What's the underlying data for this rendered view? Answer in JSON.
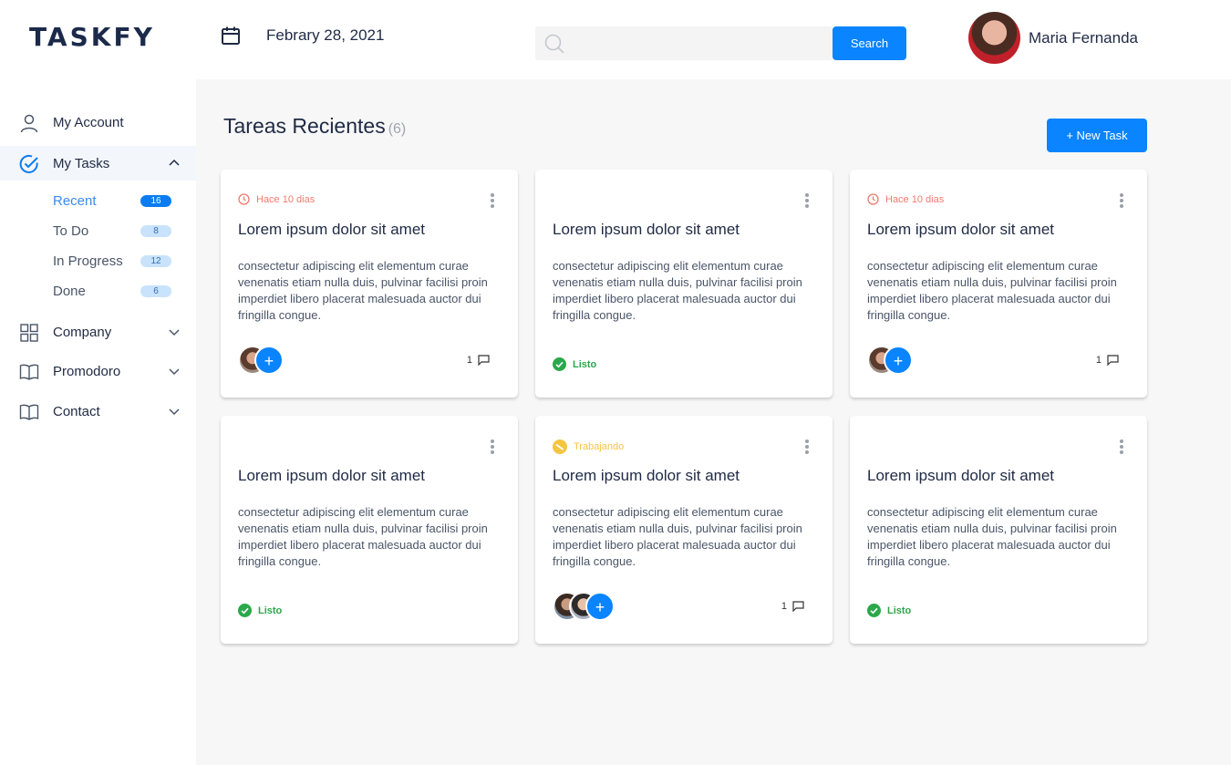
{
  "app": {
    "logo": "TASKFY"
  },
  "header": {
    "date": "Febrary 28, 2021",
    "search_placeholder": "",
    "search_button": "Search",
    "user_name": "Maria Fernanda"
  },
  "sidebar": {
    "items": [
      {
        "label": "My Account",
        "icon": "user-icon"
      },
      {
        "label": "My Tasks",
        "icon": "check-circle-icon"
      },
      {
        "label": "Company",
        "icon": "grid-icon"
      },
      {
        "label": "Promodoro",
        "icon": "book-icon"
      },
      {
        "label": "Contact",
        "icon": "book-icon"
      }
    ],
    "subitems": [
      {
        "label": "Recent",
        "count": "16"
      },
      {
        "label": "To Do",
        "count": "8"
      },
      {
        "label": "In Progress",
        "count": "12"
      },
      {
        "label": "Done",
        "count": "6"
      }
    ]
  },
  "main": {
    "title": "Tareas Recientes",
    "count": "(6)",
    "new_task_button": "+ New Task",
    "cards": [
      {
        "status": "Hace 10 dias",
        "title": "Lorem ipsum dolor sit amet",
        "description": "consectetur adipiscing elit elementum curae venenatis etiam nulla duis, pulvinar facilisi proin imperdiet libero placerat malesuada auctor dui fringilla congue.",
        "comments": "1"
      },
      {
        "title": "Lorem ipsum dolor sit amet",
        "description": "consectetur adipiscing elit elementum curae venenatis etiam nulla duis, pulvinar facilisi proin imperdiet libero placerat malesuada auctor dui fringilla congue.",
        "done_label": "Listo"
      },
      {
        "status": "Hace 10 dias",
        "title": "Lorem ipsum dolor sit amet",
        "description": "consectetur adipiscing elit elementum curae venenatis etiam nulla duis, pulvinar facilisi proin imperdiet libero placerat malesuada auctor dui fringilla congue.",
        "comments": "1"
      },
      {
        "title": "Lorem ipsum dolor sit amet",
        "description": "consectetur adipiscing elit elementum curae venenatis etiam nulla duis, pulvinar facilisi proin imperdiet libero placerat malesuada auctor dui fringilla congue.",
        "done_label": "Listo"
      },
      {
        "status": "Trabajando",
        "title": "Lorem ipsum dolor sit amet",
        "description": "consectetur adipiscing elit elementum curae venenatis etiam nulla duis, pulvinar facilisi proin imperdiet libero placerat malesuada auctor dui fringilla congue.",
        "comments": "1"
      },
      {
        "title": "Lorem ipsum dolor sit amet",
        "description": "consectetur adipiscing elit elementum curae venenatis etiam nulla duis, pulvinar facilisi proin imperdiet libero placerat malesuada auctor dui fringilla congue.",
        "done_label": "Listo"
      }
    ]
  },
  "colors": {
    "accent": "#0a84ff",
    "overdue": "#f07b6e",
    "working": "#f5c542",
    "done": "#2aa84a"
  }
}
